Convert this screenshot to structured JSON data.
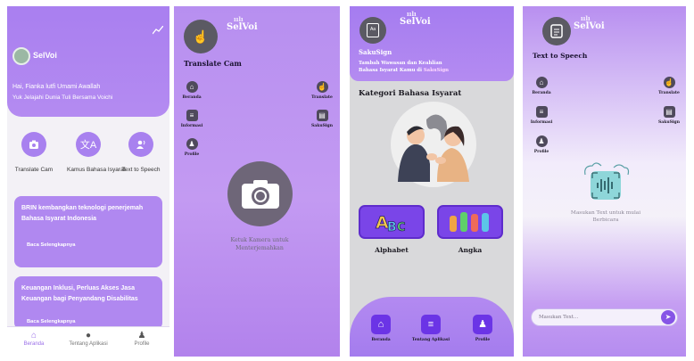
{
  "screen1": {
    "app_name": "SelVoi",
    "greeting": "Hai, Fianka lutfi Umami Awallah",
    "subtitle": "Yuk Jelajahi Dunia Tuli Bersama Voichi",
    "features": [
      {
        "label": "Translate Cam",
        "icon": "camera-icon"
      },
      {
        "label": "Kamus Bahasa Isyarat",
        "icon": "translate-icon"
      },
      {
        "label": "Text to Speech",
        "icon": "speech-icon"
      }
    ],
    "news": [
      {
        "title": "BRIN kembangkan teknologi penerjemah Bahasa Isyarat Indonesia",
        "more": "Baca Selengkapnya"
      },
      {
        "title": "Keuangan Inklusi, Perluas Akses Jasa Keuangan bagi Penyandang Disabilitas",
        "more": "Baca Selengkapnya"
      }
    ],
    "nav": [
      {
        "label": "Beranda",
        "icon": "home-icon",
        "active": true
      },
      {
        "label": "Tentang Aplikasi",
        "icon": "info-icon",
        "active": false
      },
      {
        "label": "Profile",
        "icon": "person-icon",
        "active": false
      }
    ]
  },
  "screen2": {
    "brand": "SelVoi",
    "title": "Translate Cam",
    "side_left": [
      {
        "label": "Beranda",
        "icon": "home-icon"
      },
      {
        "label": "Informasi",
        "icon": "document-icon"
      },
      {
        "label": "Profile",
        "icon": "person-icon"
      }
    ],
    "side_right": [
      {
        "label": "Translate",
        "icon": "hand-icon"
      },
      {
        "label": "SakuSign",
        "icon": "book-icon"
      }
    ],
    "hint": "Ketuk Kamera untuk Menterjemahkan"
  },
  "screen3": {
    "brand": "SelVoi",
    "logo_text": "Aa",
    "app_name": "SakuSign",
    "tagline_1": "Tambah Wawasan dan Keahlian",
    "tagline_2": "Bahasa Isyarat Kamu di",
    "tagline_highlight": "SakuSign",
    "section_title": "Kategori Bahasa Isyarat",
    "categories": [
      {
        "label": "Alphabet",
        "art": "ABC"
      },
      {
        "label": "Angka",
        "art": "hands-numbers"
      }
    ],
    "nav": [
      {
        "label": "Beranda",
        "icon": "home-icon"
      },
      {
        "label": "Tentang Aplikasi",
        "icon": "document-icon"
      },
      {
        "label": "Profile",
        "icon": "person-icon"
      }
    ]
  },
  "screen4": {
    "brand": "SelVoi",
    "title": "Text to Speech",
    "side_left": [
      {
        "label": "Beranda",
        "icon": "home-icon"
      },
      {
        "label": "Informasi",
        "icon": "document-icon"
      },
      {
        "label": "Profile",
        "icon": "person-icon"
      }
    ],
    "side_right": [
      {
        "label": "Translate",
        "icon": "hand-icon"
      },
      {
        "label": "SakuSign",
        "icon": "book-icon"
      }
    ],
    "hint": "Masukan Text untuk mulai Berbicara",
    "input_placeholder": "Masukan Text..."
  },
  "colors": {
    "primary": "#a97ff0",
    "dark_purple": "#6b34e6",
    "icon_grey": "#4f4a5c"
  }
}
